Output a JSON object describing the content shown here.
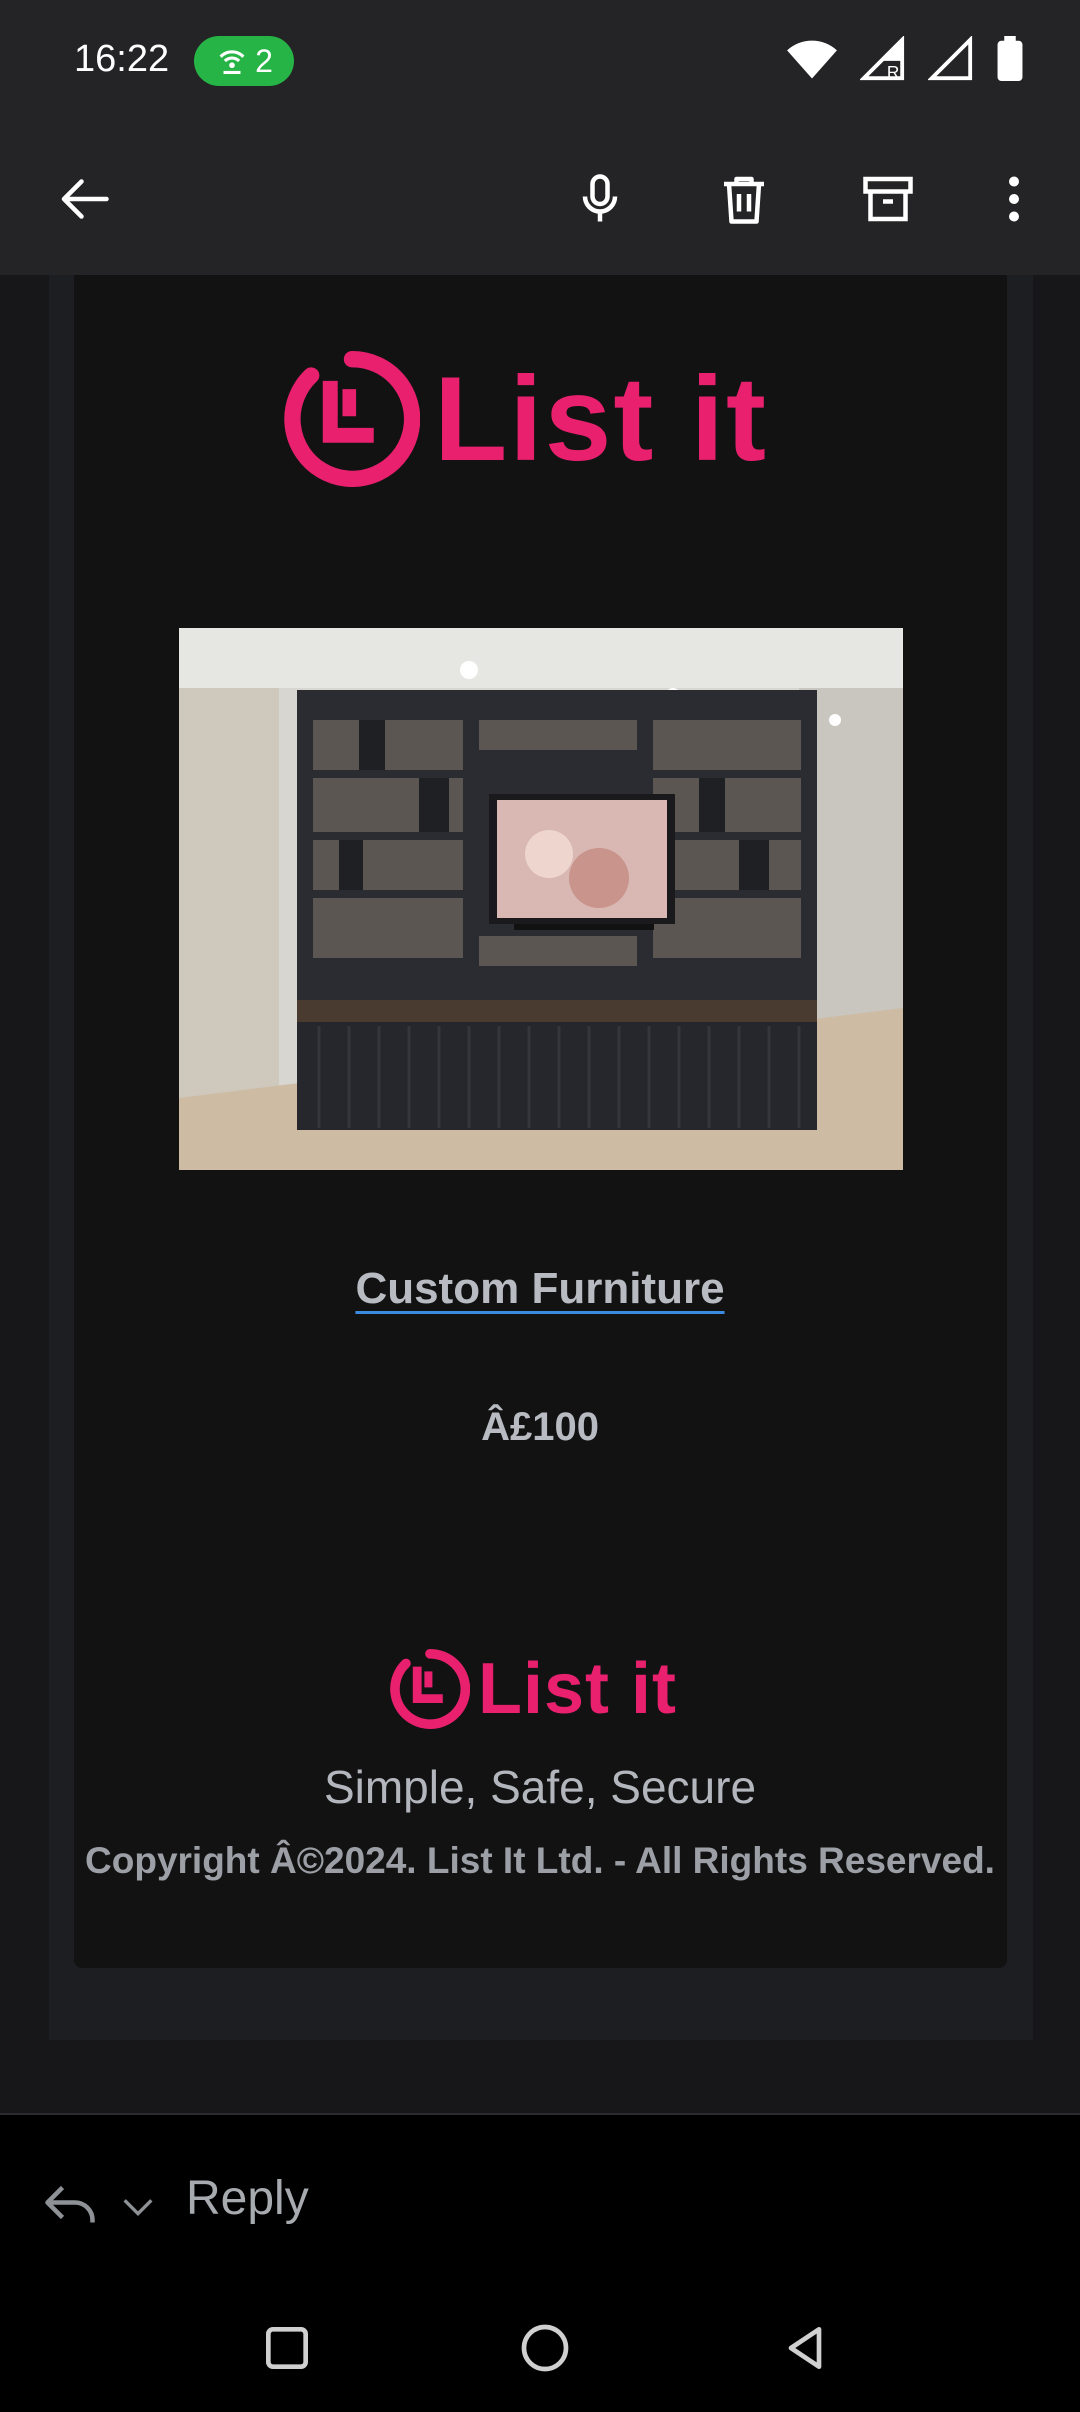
{
  "status_bar": {
    "time": "16:22",
    "hotspot_count": "2",
    "icons": [
      "hotspot-icon",
      "wifi-icon",
      "signal-roaming-icon",
      "signal-icon",
      "battery-icon"
    ]
  },
  "toolbar": {
    "icons": [
      "back-arrow-icon",
      "microphone-icon",
      "trash-icon",
      "archive-icon",
      "more-vert-icon"
    ]
  },
  "email": {
    "brand_name": "List it",
    "logo_mark": "L",
    "product_title": "Custom Furniture",
    "product_price": "Â£100",
    "footer_brand": "List it",
    "tagline": "Simple, Safe, Secure",
    "copyright": "Copyright Â©2024. List It Ltd. - All Rights Reserved."
  },
  "reply_bar": {
    "label": "Reply"
  },
  "nav_bar": {
    "icons": [
      "recents-square-icon",
      "home-circle-icon",
      "back-triangle-icon"
    ]
  },
  "colors": {
    "brand_pink": "#e8206e",
    "link_underline": "#3a8be0",
    "hotspot_green": "#27b446"
  }
}
